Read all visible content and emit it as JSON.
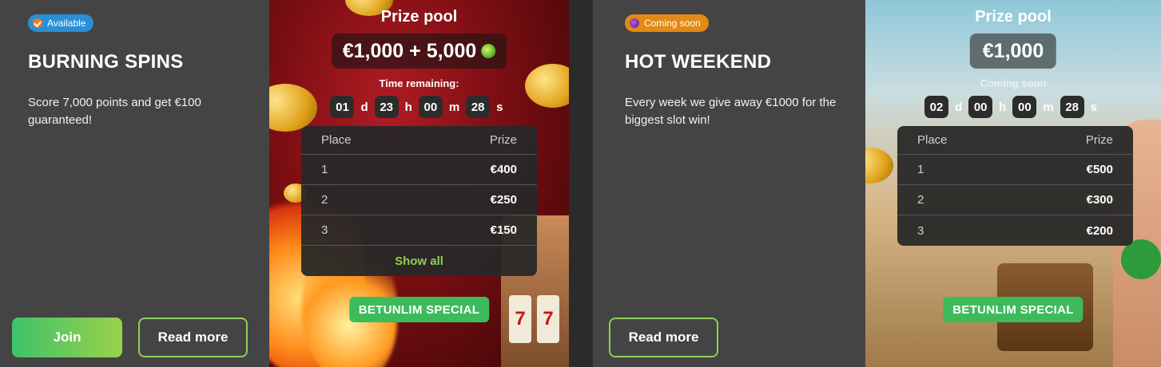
{
  "cards": [
    {
      "badge": "Available",
      "title": "BURNING SPINS",
      "description": "Score 7,000 points and get €100 guaranteed!",
      "join_label": "Join",
      "read_more_label": "Read more",
      "prize_pool_title": "Prize pool",
      "prize_pool_amount": "€1,000 + 5,000",
      "time_label": "Time remaining:",
      "timer": {
        "d": "01",
        "h": "23",
        "m": "00",
        "s": "28",
        "d_unit": "d",
        "h_unit": "h",
        "m_unit": "m",
        "s_unit": "s"
      },
      "table": {
        "headers": [
          "Place",
          "Prize"
        ],
        "rows": [
          {
            "place": "1",
            "prize": "€400"
          },
          {
            "place": "2",
            "prize": "€250"
          },
          {
            "place": "3",
            "prize": "€150"
          }
        ],
        "show_all": "Show all"
      },
      "special_label": "BETUNLIM SPECIAL"
    },
    {
      "badge": "Coming soon",
      "title": "HOT WEEKEND",
      "description": "Every week we give away €1000 for the biggest slot win!",
      "read_more_label": "Read more",
      "prize_pool_title": "Prize pool",
      "prize_pool_amount": "€1,000",
      "time_label": "Coming soon",
      "timer": {
        "d": "02",
        "h": "00",
        "m": "00",
        "s": "28",
        "d_unit": "d",
        "h_unit": "h",
        "m_unit": "m",
        "s_unit": "s"
      },
      "table": {
        "headers": [
          "Place",
          "Prize"
        ],
        "rows": [
          {
            "place": "1",
            "prize": "€500"
          },
          {
            "place": "2",
            "prize": "€300"
          },
          {
            "place": "3",
            "prize": "€200"
          }
        ]
      },
      "special_label": "BETUNLIM SPECIAL"
    }
  ],
  "colors": {
    "panel_bg": "#444444",
    "accent_green": "#8dcf55",
    "badge_available": "#2b8fd6",
    "badge_soon": "#e28a15",
    "special_bg": "#3dbb5b"
  }
}
